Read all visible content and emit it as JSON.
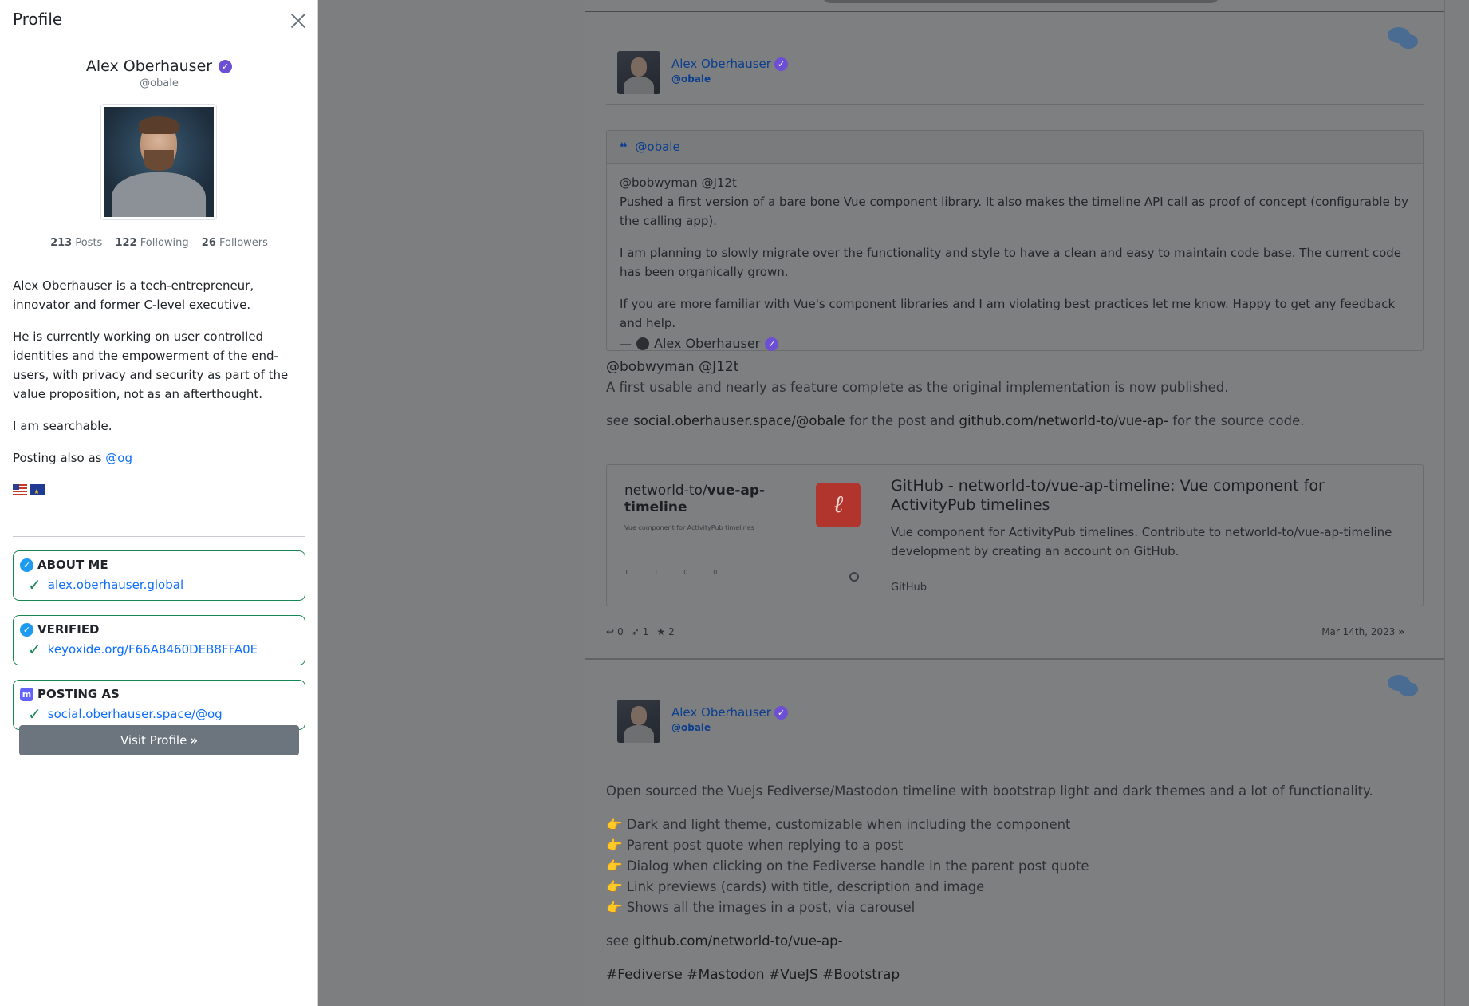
{
  "panel": {
    "title": "Profile",
    "name": "Alex Oberhauser",
    "handle": "@obale",
    "stats": {
      "posts": "213",
      "posts_label": "Posts",
      "following": "122",
      "following_label": "Following",
      "followers": "26",
      "followers_label": "Followers"
    },
    "bio": [
      "Alex Oberhauser is a tech-entrepreneur, innovator and former C-level executive.",
      "He is currently working on user controlled identities and the empowerment of the end-users, with privacy and security as part of the value proposition, not as an afterthought.",
      "I am searchable."
    ],
    "posting_also_as": "Posting also as",
    "posting_also_handle": "@og",
    "claims": [
      {
        "title": "ABOUT ME",
        "icon": "check-circle-icon",
        "link": "alex.oberhauser.global"
      },
      {
        "title": "VERIFIED",
        "icon": "check-circle-icon",
        "link": "keyoxide.org/F66A8460DEB8FFA0E"
      },
      {
        "title": "POSTING AS",
        "icon": "mastodon-icon",
        "link": "social.oberhauser.space/@og"
      }
    ],
    "visit_label": "Visit Profile"
  },
  "posts": [
    {
      "author": "Alex Oberhauser",
      "handle": "@obale",
      "quote": {
        "handle": "@obale",
        "mentions": "@bobwyman @J12t",
        "line1": "Pushed a first version of a bare bone Vue component library. It also makes the timeline API call as proof of concept (configurable by the calling app).",
        "line2": "I am planning to slowly migrate over the functionality and style to have a clean and easy to maintain code base. The current code has been organically grown.",
        "line3": "If you are more familiar with Vue's component libraries and I am violating best practices let me know. Happy to get any feedback and help.",
        "sig_prefix": "—",
        "sig_name": "Alex Oberhauser"
      },
      "mentions": "@bobwyman @J12t",
      "text1": "A first usable and nearly as feature complete as the original implementation is now published.",
      "see": "see",
      "link1": "social.oberhauser.space/@obale",
      "mid": "for the post and",
      "link2": "github.com/networld-to/vue-ap-",
      "tail": "for the source code.",
      "card": {
        "thumb_repo_owner": "networld-to/",
        "thumb_repo_name": "vue-ap-",
        "thumb_repo_name2": "timeline",
        "thumb_sub": "Vue component for ActivityPub timelines",
        "thumb_stats": [
          "1",
          "1",
          "0",
          "0"
        ],
        "title": "GitHub - networld-to/vue-ap-timeline: Vue component for ActivityPub timelines",
        "desc": "Vue component for ActivityPub timelines. Contribute to networld-to/vue-ap-timeline development by creating an account on GitHub.",
        "site": "GitHub"
      },
      "replies": "0",
      "boosts": "1",
      "favs": "2",
      "date": "Mar 14th, 2023"
    },
    {
      "author": "Alex Oberhauser",
      "handle": "@obale",
      "text1": "Open sourced the Vuejs Fediverse/Mastodon timeline with bootstrap light and dark themes and a lot of functionality.",
      "list": [
        "Dark and light theme, customizable when including the component",
        "Parent post quote when replying to a post",
        "Dialog when clicking on the Fediverse handle in the parent post quote",
        "Link previews (cards) with title, description and image",
        "Shows all the images in a post, via carousel"
      ],
      "see": "see",
      "link": "github.com/networld-to/vue-ap-",
      "tags": "#Fediverse #Mastodon #VueJS #Bootstrap"
    }
  ]
}
